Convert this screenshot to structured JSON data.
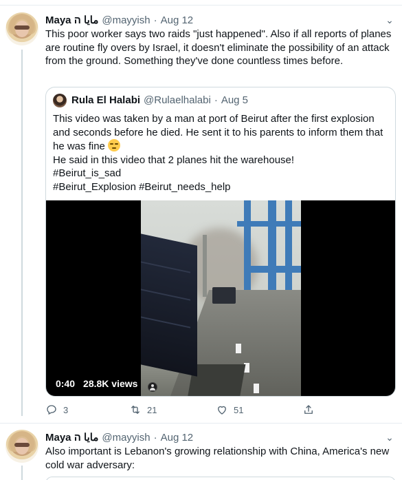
{
  "tweet1": {
    "name": "Maya مايا ה",
    "handle": "@mayyish",
    "separator": "·",
    "date": "Aug 12",
    "text": "This poor worker says two raids \"just happened\". Also if all reports of planes are routine fly overs by Israel, it doesn't eliminate the possibility of an attack from the ground. Something they've done countless times before."
  },
  "quoted": {
    "name": "Rula El Halabi",
    "handle": "@Rulaelhalabi",
    "separator": "·",
    "date": "Aug 5",
    "text_line1": "This video was taken by a man at port of Beirut after the first explosion and seconds before he died. He sent it to his parents to inform them that he was fine",
    "text_line2": "He said in this video that 2 planes hit the warehouse!",
    "text_line3": "#Beirut_is_sad",
    "text_line4": "#Beirut_Explosion #Beirut_needs_help",
    "emoji": "disappointed-face",
    "video": {
      "duration": "0:40",
      "views": "28.8K views"
    }
  },
  "actions": {
    "replies": "3",
    "retweets": "21",
    "likes": "51"
  },
  "tweet2": {
    "name": "Maya مايا ה",
    "handle": "@mayyish",
    "separator": "·",
    "date": "Aug 12",
    "text": "Also important is Lebanon's growing relationship with China, America's new cold war adversary:"
  },
  "colors": {
    "text": "#0f1419",
    "secondary": "#536471",
    "border": "#cfd9de",
    "crane": "#3f7bb8"
  }
}
